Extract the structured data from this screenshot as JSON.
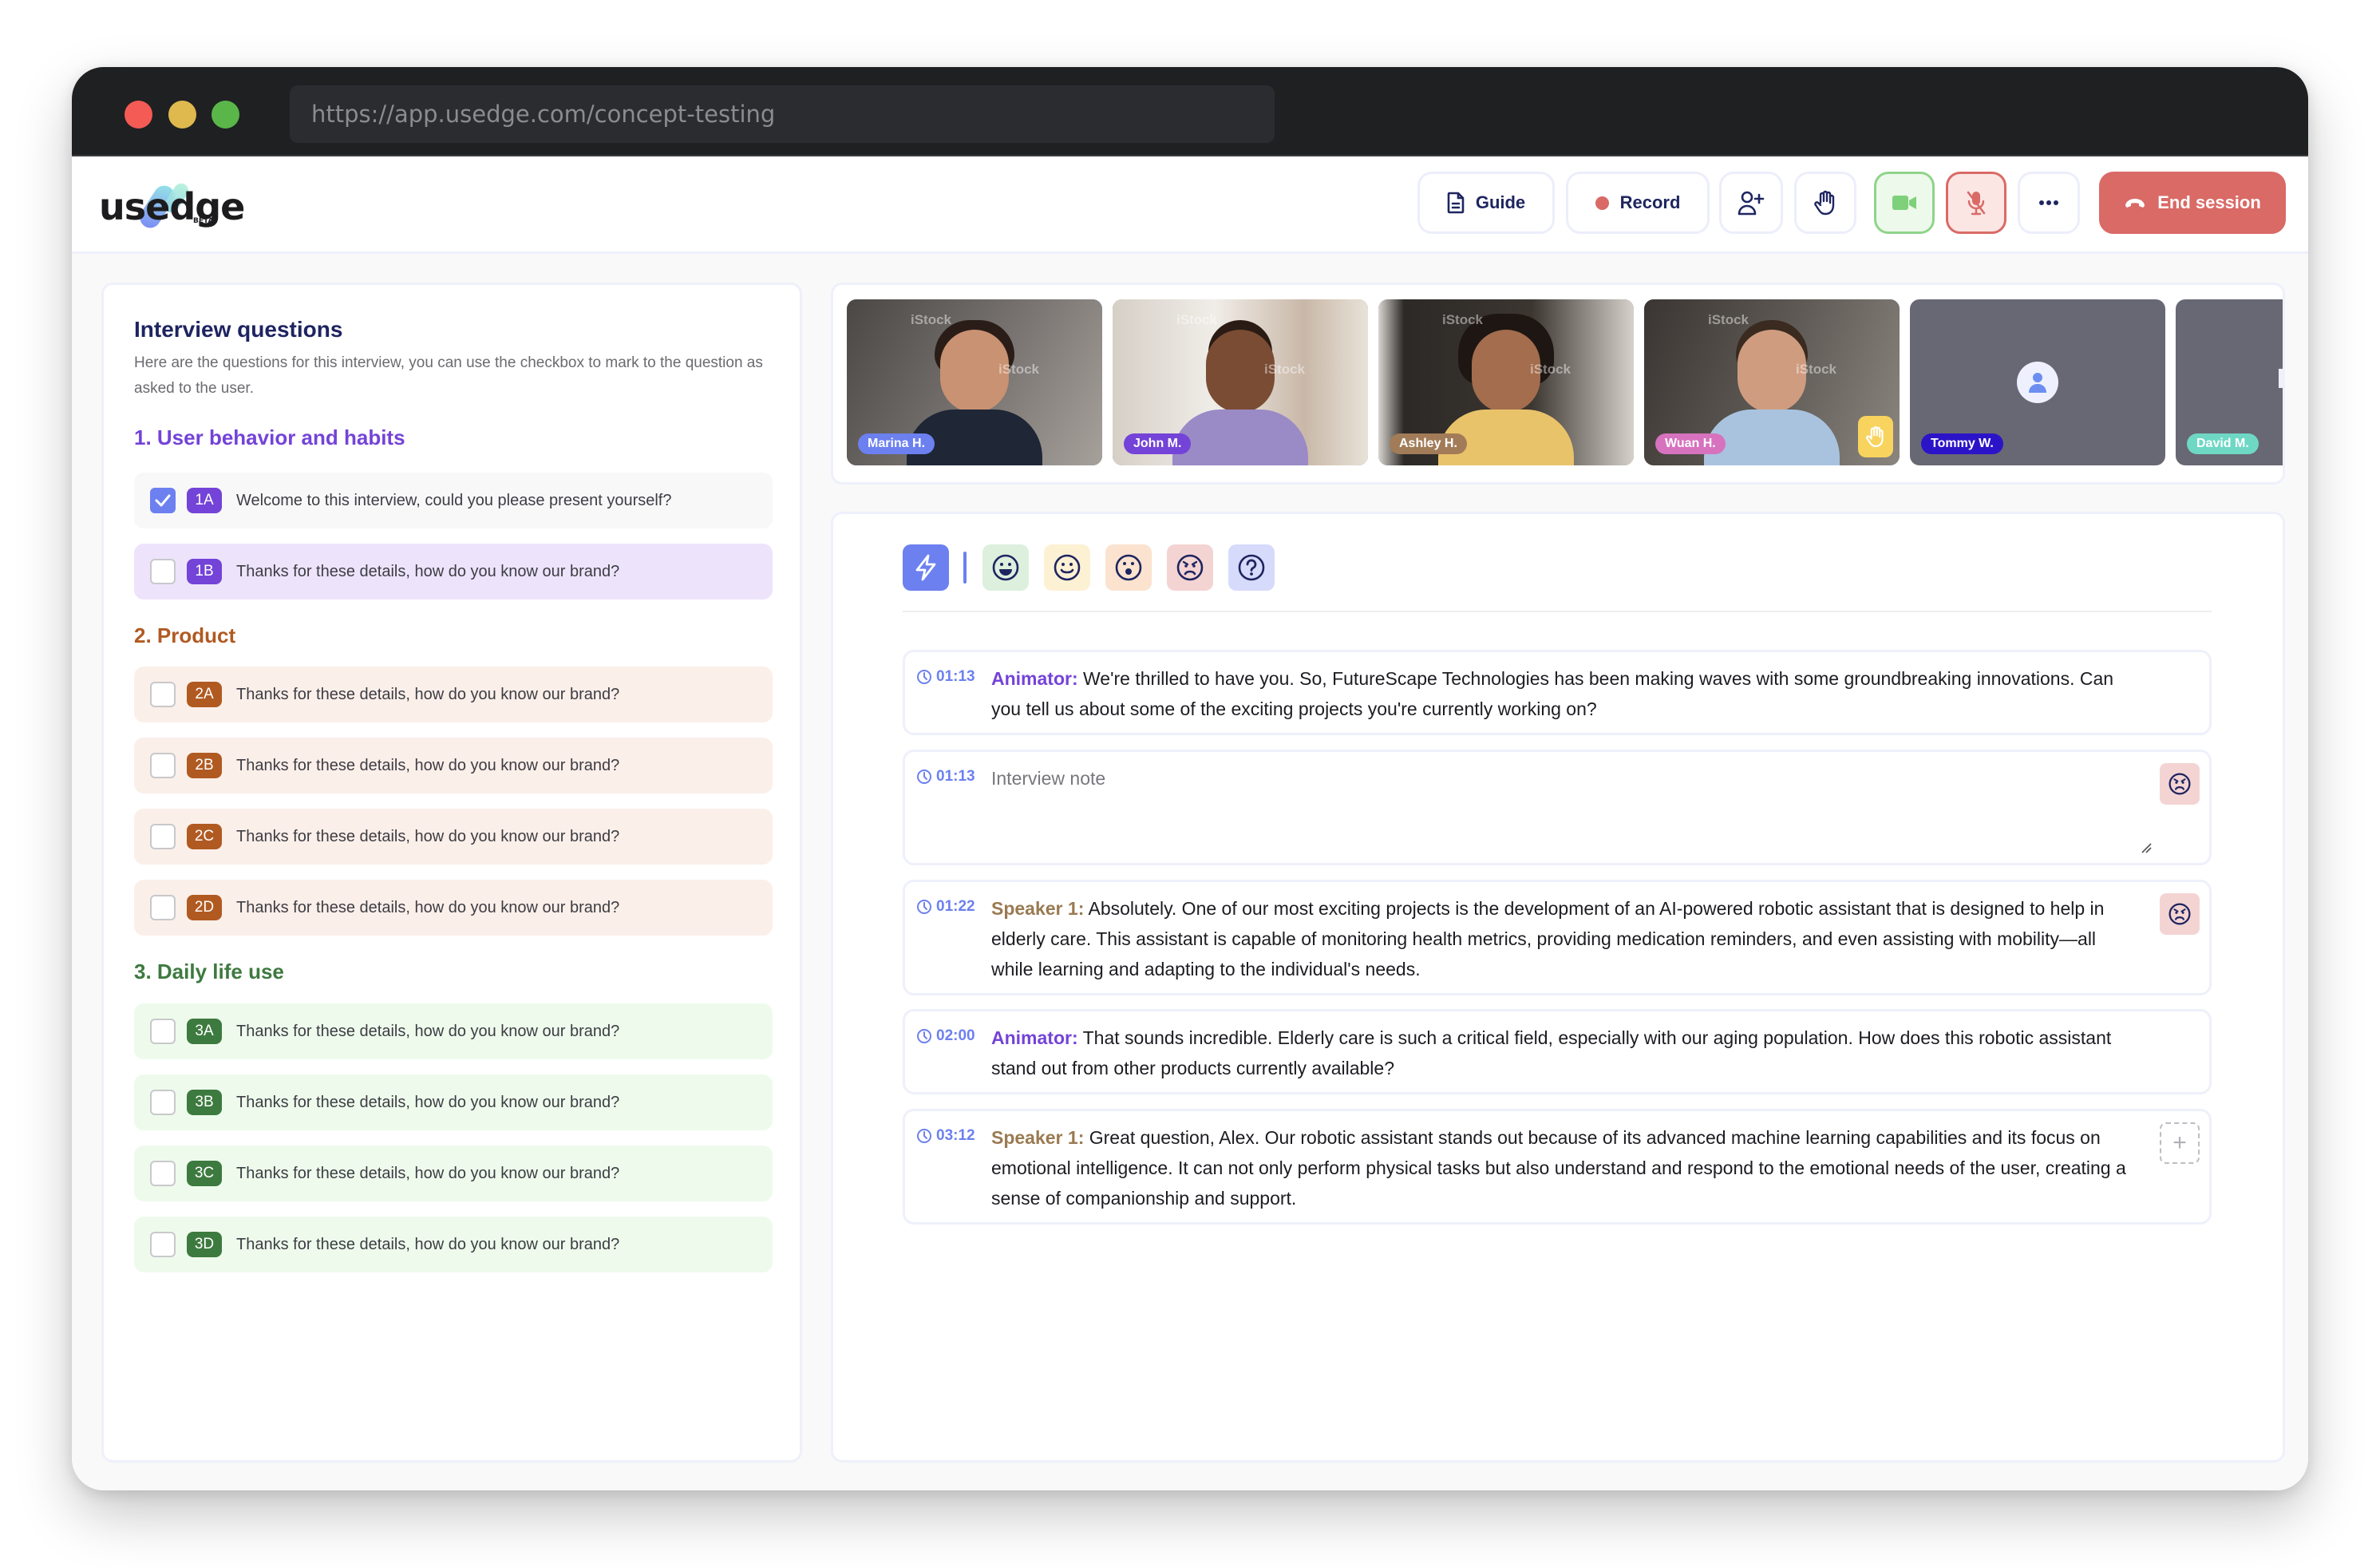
{
  "browser": {
    "url": "https://app.usedge.com/concept-testing"
  },
  "header": {
    "logo_text": "usedge",
    "logo_badge": "BETA",
    "buttons": {
      "guide": "Guide",
      "record": "Record",
      "end_session": "End session"
    },
    "colors": {
      "end_session": "#d96a66",
      "video_on": "#8fd48b",
      "mic_muted": "#d96a66",
      "record_dot": "#d96a66"
    }
  },
  "questions_panel": {
    "title": "Interview questions",
    "description": "Here are the questions for this interview, you can use the checkbox to mark to the question as asked to the user.",
    "sections": [
      {
        "title": "1. User behavior and habits",
        "color": "#7443d8",
        "items": [
          {
            "code": "1A",
            "text": "Welcome to this interview, could you please present yourself?",
            "checked": true
          },
          {
            "code": "1B",
            "text": "Thanks for these details, how do you know our brand?",
            "checked": false
          }
        ]
      },
      {
        "title": "2. Product",
        "color": "#b05a22",
        "items": [
          {
            "code": "2A",
            "text": "Thanks for these details, how do you know our brand?",
            "checked": false
          },
          {
            "code": "2B",
            "text": "Thanks for these details, how do you know our brand?",
            "checked": false
          },
          {
            "code": "2C",
            "text": "Thanks for these details, how do you know our brand?",
            "checked": false
          },
          {
            "code": "2D",
            "text": "Thanks for these details, how do you know our brand?",
            "checked": false
          }
        ]
      },
      {
        "title": "3. Daily life use",
        "color": "#3d7a3f",
        "items": [
          {
            "code": "3A",
            "text": "Thanks for these details, how do you know our brand?",
            "checked": false
          },
          {
            "code": "3B",
            "text": "Thanks for these details, how do you know our brand?",
            "checked": false
          },
          {
            "code": "3C",
            "text": "Thanks for these details, how do you know our brand?",
            "checked": false
          },
          {
            "code": "3D",
            "text": "Thanks for these details, how do you know our brand?",
            "checked": false
          }
        ]
      }
    ]
  },
  "participants": [
    {
      "name": "Marina H.",
      "tag_color": "#6c80f0",
      "video": true,
      "hand_raised": false
    },
    {
      "name": "John M.",
      "tag_color": "#7443d8",
      "video": true,
      "hand_raised": false
    },
    {
      "name": "Ashley H.",
      "tag_color": "#a27c58",
      "video": true,
      "hand_raised": false
    },
    {
      "name": "Wuan H.",
      "tag_color": "#d772bf",
      "video": true,
      "hand_raised": true
    },
    {
      "name": "Tommy W.",
      "tag_color": "#2b14c8",
      "video": false,
      "hand_raised": false
    },
    {
      "name": "David M.",
      "tag_color": "#6fd8c5",
      "video": false,
      "hand_raised": false
    }
  ],
  "video_watermark": "iStock",
  "reactions_toolbar": [
    {
      "name": "lightning",
      "bg": "#6c80f0"
    },
    {
      "name": "laughing-face",
      "bg": "#dcf0dd"
    },
    {
      "name": "smiling-face",
      "bg": "#fdf1d4"
    },
    {
      "name": "surprised-face",
      "bg": "#fbe3cf"
    },
    {
      "name": "angry-face",
      "bg": "#f4d4d3"
    },
    {
      "name": "question",
      "bg": "#d6dbfb"
    }
  ],
  "notes": [
    {
      "time": "01:13",
      "speaker": "Animator:",
      "text": "We're thrilled to have you. So, FutureScape Technologies has been making waves with some groundbreaking innovations. Can you tell us about some of the exciting projects you're currently working on?",
      "reaction": null
    },
    {
      "time": "01:13",
      "placeholder": "Interview note",
      "reaction": "angry-face"
    },
    {
      "time": "01:22",
      "speaker": "Speaker 1:",
      "text": "Absolutely. One of our most exciting projects is the development of an AI-powered robotic assistant that is designed to help in elderly care. This assistant is capable of monitoring health metrics, providing medication reminders, and even assisting with mobility—all while learning and adapting to the individual's needs.",
      "reaction": "angry-face"
    },
    {
      "time": "02:00",
      "speaker": "Animator:",
      "text": "That sounds incredible. Elderly care is such a critical field, especially with our aging population. How does this robotic assistant stand out from other products currently available?",
      "reaction": null
    },
    {
      "time": "03:12",
      "speaker": "Speaker 1:",
      "text": "Great question, Alex. Our robotic assistant stands out because of its advanced machine learning capabilities and its focus on emotional intelligence. It can not only perform physical tasks but also understand and respond to the emotional needs of the user, creating a sense of companionship and support.",
      "reaction": "add"
    }
  ]
}
